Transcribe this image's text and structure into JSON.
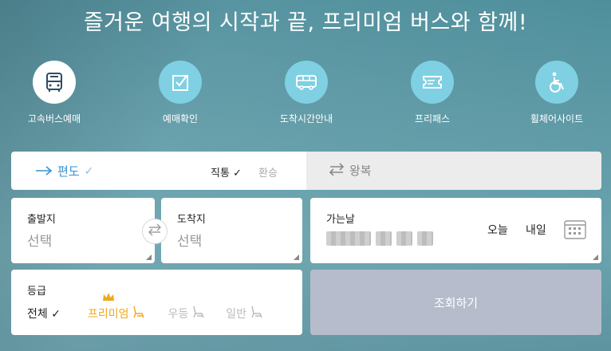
{
  "headline": "즐거운 여행의 시작과 끝, 프리미엄 버스와 함께!",
  "menu": [
    {
      "label": "고속버스예매",
      "icon": "bus-icon",
      "active": true
    },
    {
      "label": "예매확인",
      "icon": "checkbox-icon",
      "active": false
    },
    {
      "label": "도착시간안내",
      "icon": "bus-arrival-icon",
      "active": false
    },
    {
      "label": "프리패스",
      "icon": "ticket-icon",
      "active": false
    },
    {
      "label": "휠체어사이트",
      "icon": "wheelchair-icon",
      "active": false
    }
  ],
  "trip": {
    "oneway_label": "편도",
    "direct_label": "직통",
    "transfer_label": "환승",
    "round_label": "왕복"
  },
  "route": {
    "departure_label": "출발지",
    "departure_value": "선택",
    "arrival_label": "도착지",
    "arrival_value": "선택"
  },
  "date": {
    "label": "가는날",
    "today": "오늘",
    "tomorrow": "내일"
  },
  "grade": {
    "label": "등급",
    "all": "전체",
    "premium": "프리미엄",
    "superior": "우등",
    "standard": "일반"
  },
  "search_label": "조회하기",
  "colors": {
    "accent": "#3a8fd0",
    "premium": "#f0a81d",
    "menu_circle": "#7fd0e2",
    "search_button": "#b6bccb"
  }
}
